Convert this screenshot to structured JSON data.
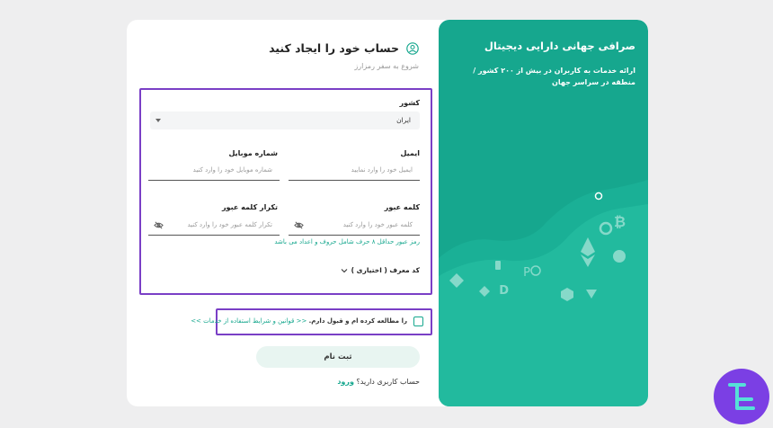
{
  "promo": {
    "heading": "صرافی جهانی دارایی دیجیتال",
    "description": "ارائه خدمات به کاربران در بیش از ۲۰۰ کشور / منطقه در سراسر جهان",
    "coin_icons": [
      "bitcoin-icon",
      "ethereum-icon",
      "cardano-icon",
      "dogecoin-icon",
      "polkadot-icon",
      "tron-icon",
      "binance-icon"
    ]
  },
  "form": {
    "title": "حساب خود را ایجاد کنید",
    "subtitle": "شروع به سفر رمزارز",
    "country": {
      "label": "کشور",
      "value": "ایران"
    },
    "email": {
      "label": "ایمیل",
      "placeholder": "ایمیل خود را وارد نمایید"
    },
    "mobile": {
      "label": "شماره موبایل",
      "placeholder": "شماره موبایل خود را وارد کنید"
    },
    "password": {
      "label": "کلمه عبور",
      "placeholder": "کلمه عبور خود را وارد کنید"
    },
    "password_confirm": {
      "label": "تکرار کلمه عبور",
      "placeholder": "تکرار کلمه عبور خود را وارد کنید"
    },
    "password_hint": "رمز عبور حداقل ۸ حرف شامل حروف و اعداد می باشد",
    "referral_label": "کد معرف ( اختیاری )",
    "terms_link": "<< قوانین و شرایط استفاده از خدمات >>",
    "terms_text": "را مطالعه کرده ام و قبول دارم.",
    "submit_label": "ثبت نام",
    "have_account": "حساب کاربری دارید؟",
    "login_link": "ورود"
  },
  "colors": {
    "accent": "#16a78e",
    "highlight": "#7a3fc6",
    "brand": "#7b3fe4"
  }
}
